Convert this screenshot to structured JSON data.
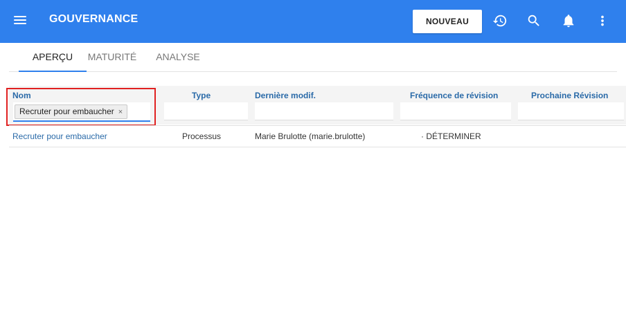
{
  "app": {
    "title": "GOUVERNANCE"
  },
  "toolbar": {
    "new_label": "NOUVEAU",
    "icons": [
      "history-icon",
      "search-icon",
      "bell-icon",
      "more-vert-icon"
    ]
  },
  "tabs": [
    {
      "label": "APERÇU",
      "active": true
    },
    {
      "label": "MATURITÉ",
      "active": false
    },
    {
      "label": "ANALYSE",
      "active": false
    }
  ],
  "table": {
    "columns": [
      "Nom",
      "Type",
      "Dernière modif.",
      "Fréquence de révision",
      "Prochaine Révision"
    ],
    "filters": {
      "name_chip": "Recruter pour embaucher",
      "chip_close": "×"
    },
    "rows": [
      {
        "name": "Recruter pour embaucher",
        "type": "Processus",
        "last_modified": "Marie Brulotte (marie.brulotte)",
        "frequency": "· DÉTERMINER",
        "next_review": ""
      }
    ]
  },
  "colors": {
    "accent": "#2f80ed",
    "link": "#2a6aa8",
    "highlight": "#e02020"
  }
}
